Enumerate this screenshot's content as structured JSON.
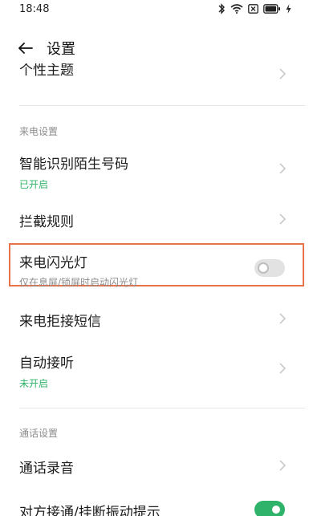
{
  "status_bar": {
    "time": "18:48"
  },
  "header": {
    "title": "设置"
  },
  "rows": {
    "personal_theme": {
      "title": "个性主题"
    },
    "section_incoming": "来电设置",
    "smart_id": {
      "title": "智能识别陌生号码",
      "status": "已开启"
    },
    "intercept_rules": {
      "title": "拦截规则"
    },
    "flash_light": {
      "title": "来电闪光灯",
      "subtitle": "仅在息屏/锁屏时启动闪光灯",
      "enabled": false
    },
    "sms_reject": {
      "title": "来电拒接短信"
    },
    "auto_answer": {
      "title": "自动接听",
      "status": "未开启"
    },
    "section_call": "通话设置",
    "call_recording": {
      "title": "通话录音"
    },
    "vibration_prompt": {
      "title": "对方接通/挂断振动提示",
      "enabled": true
    }
  },
  "colors": {
    "accent_green": "#2fb36a",
    "highlight_orange": "#e8734a"
  }
}
